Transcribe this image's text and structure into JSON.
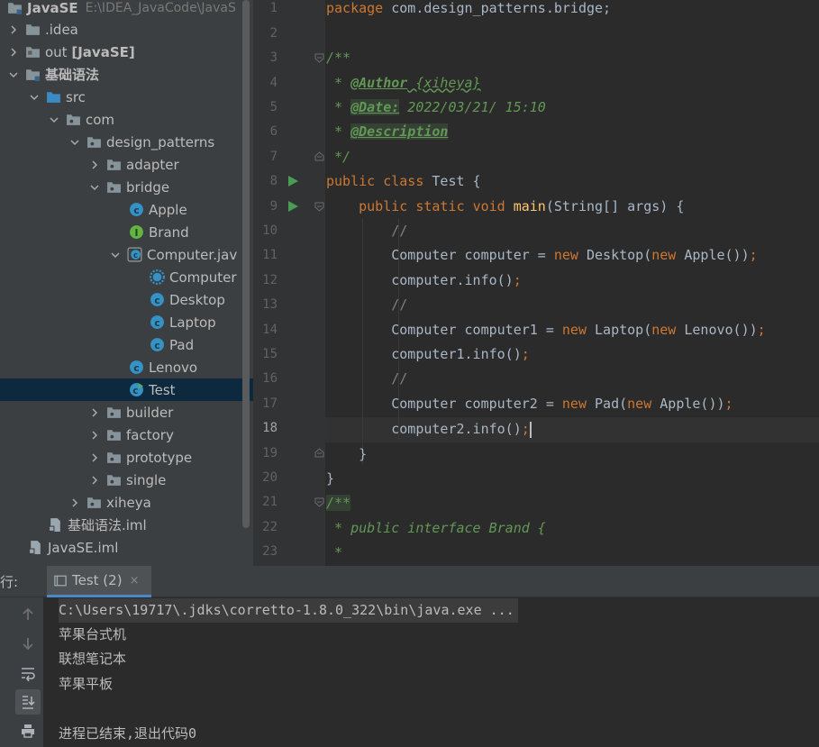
{
  "project_tree": {
    "root": {
      "name": "JavaSE",
      "path": "E:\\IDEA_JavaCode\\JavaS"
    },
    "items": [
      {
        "label": ".idea"
      },
      {
        "label": "out",
        "suffix": "[JavaSE]"
      },
      {
        "label": "基础语法"
      },
      {
        "label": "src"
      },
      {
        "label": "com"
      },
      {
        "label": "design_patterns"
      },
      {
        "label": "adapter"
      },
      {
        "label": "bridge"
      },
      {
        "label": "Apple"
      },
      {
        "label": "Brand"
      },
      {
        "label": "Computer.jav"
      },
      {
        "label": "Computer"
      },
      {
        "label": "Desktop"
      },
      {
        "label": "Laptop"
      },
      {
        "label": "Pad"
      },
      {
        "label": "Lenovo"
      },
      {
        "label": "Test"
      },
      {
        "label": "builder"
      },
      {
        "label": "factory"
      },
      {
        "label": "prototype"
      },
      {
        "label": "single"
      },
      {
        "label": "xiheya"
      },
      {
        "label": "基础语法.iml"
      },
      {
        "label": "JavaSE.iml"
      }
    ]
  },
  "editor": {
    "line_numbers": [
      "1",
      "2",
      "3",
      "4",
      "5",
      "6",
      "7",
      "8",
      "9",
      "10",
      "11",
      "12",
      "13",
      "14",
      "15",
      "16",
      "17",
      "18",
      "19",
      "20",
      "21",
      "22",
      "23"
    ],
    "current_line": "18",
    "code": {
      "l1_kw": "package",
      "l1_rest": " com.design_patterns.bridge;",
      "l3": "/**",
      "l4_star": " * ",
      "l4_tag": "@Author",
      "l4_val": " {xiheya}",
      "l5_star": " * ",
      "l5_tag": "@Date:",
      "l5_val": " 2022/03/21/ 15:10",
      "l6_star": " * ",
      "l6_tag": "@Description",
      "l7": " */",
      "l8_kw1": "public",
      "l8_kw2": "class",
      "l8_rest": " Test {",
      "l9_kw1": "public",
      "l9_kw2": "static",
      "l9_kw3": "void",
      "l9_fn": "main",
      "l9_rest": "(String[] args) {",
      "l10": "//",
      "l11_a": "Computer computer = ",
      "l11_new1": "new",
      "l11_b": " Desktop(",
      "l11_new2": "new",
      "l11_c": " Apple())",
      "l11_d": ";",
      "l12_a": "computer.info()",
      "l12_b": ";",
      "l13": "//",
      "l14_a": "Computer computer1 = ",
      "l14_new1": "new",
      "l14_b": " Laptop(",
      "l14_new2": "new",
      "l14_c": " Lenovo())",
      "l14_d": ";",
      "l15_a": "computer1.info()",
      "l15_b": ";",
      "l16": "//",
      "l17_a": "Computer computer2 = ",
      "l17_new1": "new",
      "l17_b": " Pad(",
      "l17_new2": "new",
      "l17_c": " Apple())",
      "l17_d": ";",
      "l18_a": "computer2.info()",
      "l18_b": ";",
      "l19": "}",
      "l20": "}",
      "l21": "/**",
      "l22": " * public interface Brand {",
      "l23": " *"
    }
  },
  "run_panel": {
    "title": "行:",
    "tab_label": "Test (2)",
    "tab_close": "×",
    "console_lines": [
      "C:\\Users\\19717\\.jdks\\corretto-1.8.0_322\\bin\\java.exe ...",
      "苹果台式机",
      "联想笔记本",
      "苹果平板",
      "",
      "进程已结束,退出代码0"
    ]
  },
  "colors": {
    "keyword": "#cc7832",
    "comment": "#629755",
    "function": "#ffc66d",
    "text": "#a9b7c6",
    "selection": "#0d293e",
    "class_icon": "#3592c4",
    "interface_icon": "#62b543"
  }
}
